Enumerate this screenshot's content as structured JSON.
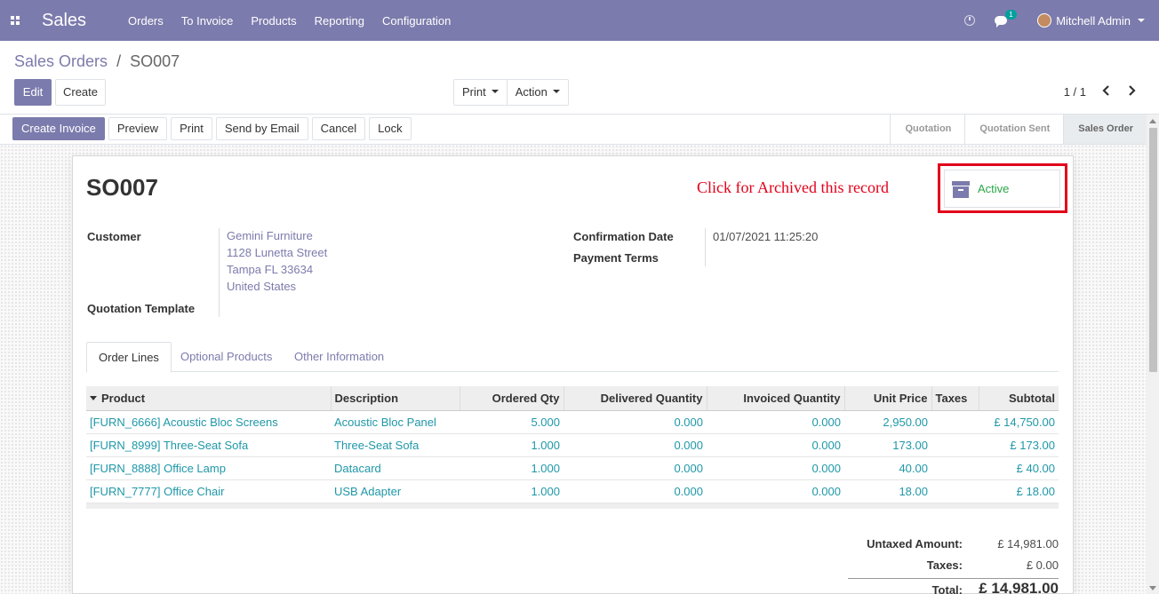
{
  "navbar": {
    "app_name": "Sales",
    "menu": [
      "Orders",
      "To Invoice",
      "Products",
      "Reporting",
      "Configuration"
    ],
    "chat_badge": "1",
    "user": "Mitchell Admin"
  },
  "control": {
    "breadcrumb_parent": "Sales Orders",
    "breadcrumb_sep": "/",
    "breadcrumb_current": "SO007",
    "edit_label": "Edit",
    "create_label": "Create",
    "print_label": "Print",
    "action_label": "Action",
    "pager": "1 / 1"
  },
  "statusbar": {
    "buttons": [
      "Create Invoice",
      "Preview",
      "Print",
      "Send by Email",
      "Cancel",
      "Lock"
    ],
    "stages": [
      "Quotation",
      "Quotation Sent",
      "Sales Order"
    ],
    "current_stage": "Sales Order"
  },
  "form": {
    "name": "SO007",
    "annotation": "Click for Archived this record",
    "active_label": "Active",
    "customer_label": "Customer",
    "customer_name": "Gemini Furniture",
    "customer_address": [
      "1128 Lunetta Street",
      "Tampa FL 33634",
      "United States"
    ],
    "quotation_template_label": "Quotation Template",
    "confirmation_date_label": "Confirmation Date",
    "confirmation_date": "01/07/2021 11:25:20",
    "payment_terms_label": "Payment Terms"
  },
  "tabs": [
    "Order Lines",
    "Optional Products",
    "Other Information"
  ],
  "order_lines": {
    "columns": [
      "Product",
      "Description",
      "Ordered Qty",
      "Delivered Quantity",
      "Invoiced Quantity",
      "Unit Price",
      "Taxes",
      "Subtotal"
    ],
    "rows": [
      [
        "[FURN_6666] Acoustic Bloc Screens",
        "Acoustic Bloc Panel",
        "5.000",
        "0.000",
        "0.000",
        "2,950.00",
        "",
        "£ 14,750.00"
      ],
      [
        "[FURN_8999] Three-Seat Sofa",
        "Three-Seat Sofa",
        "1.000",
        "0.000",
        "0.000",
        "173.00",
        "",
        "£ 173.00"
      ],
      [
        "[FURN_8888] Office Lamp",
        "Datacard",
        "1.000",
        "0.000",
        "0.000",
        "40.00",
        "",
        "£ 40.00"
      ],
      [
        "[FURN_7777] Office Chair",
        "USB Adapter",
        "1.000",
        "0.000",
        "0.000",
        "18.00",
        "",
        "£ 18.00"
      ]
    ]
  },
  "totals": {
    "untaxed_label": "Untaxed Amount:",
    "untaxed": "£ 14,981.00",
    "taxes_label": "Taxes:",
    "taxes": "£ 0.00",
    "total_label": "Total:",
    "total": "£ 14,981.00"
  }
}
